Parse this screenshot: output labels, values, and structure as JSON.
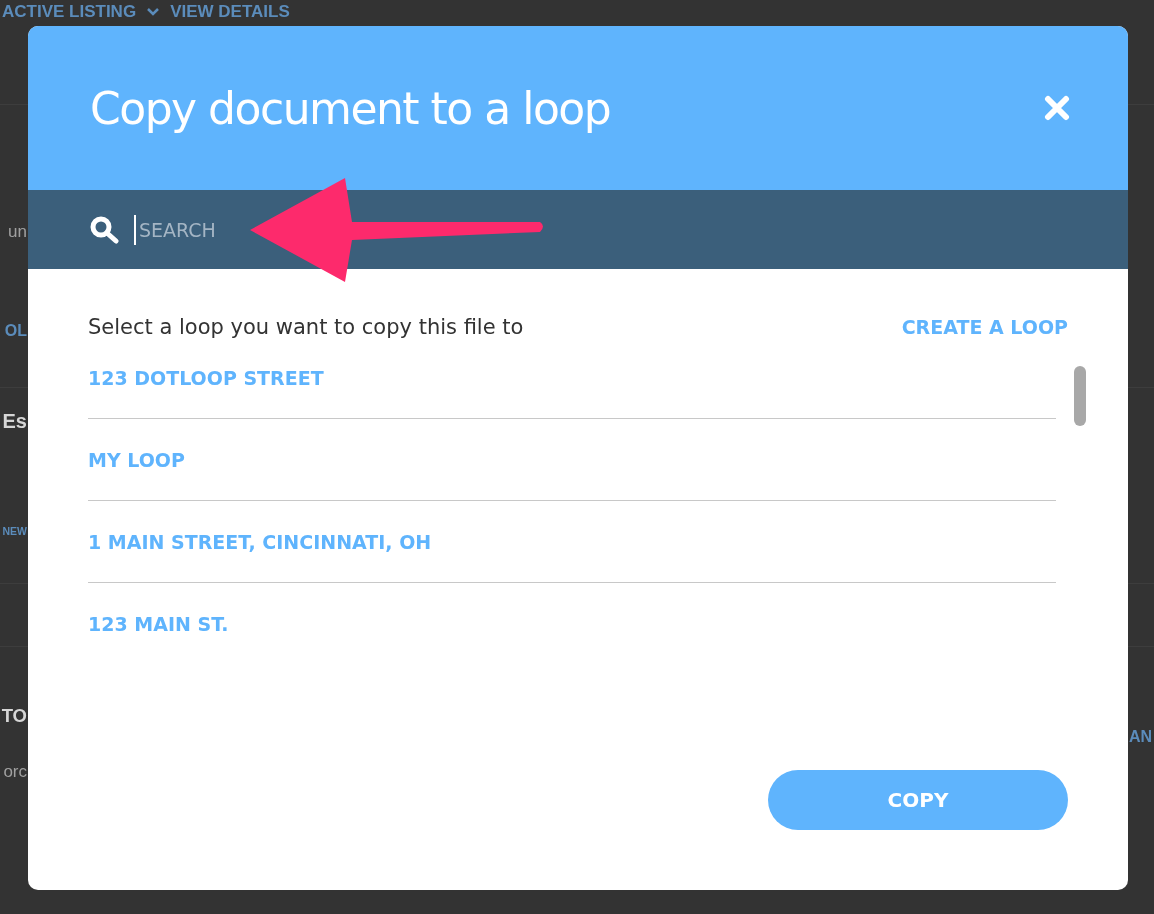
{
  "background": {
    "top_links": [
      {
        "label": "ACTIVE LISTING",
        "kind": "dropdown"
      },
      {
        "label": "VIEW DETAILS",
        "kind": "link"
      }
    ],
    "left_fragments": [
      {
        "text": "un",
        "kind": "text"
      },
      {
        "text": "OL",
        "kind": "link"
      },
      {
        "text": "Es",
        "kind": "heading"
      },
      {
        "text": "NEW",
        "kind": "link"
      },
      {
        "text": "TO",
        "kind": "title"
      },
      {
        "text": "orc",
        "kind": "text"
      }
    ],
    "right_fragments": [
      {
        "text": "AN",
        "kind": "link"
      }
    ]
  },
  "modal": {
    "title": "Copy document to a loop",
    "search": {
      "placeholder": "SEARCH"
    },
    "prompt": "Select a loop you want to copy this file to",
    "create_link": "CREATE A LOOP",
    "loops": [
      "123 DOTLOOP STREET",
      "MY LOOP",
      "1 MAIN STREET, CINCINNATI, OH",
      "123 MAIN ST."
    ],
    "button": "COPY"
  }
}
